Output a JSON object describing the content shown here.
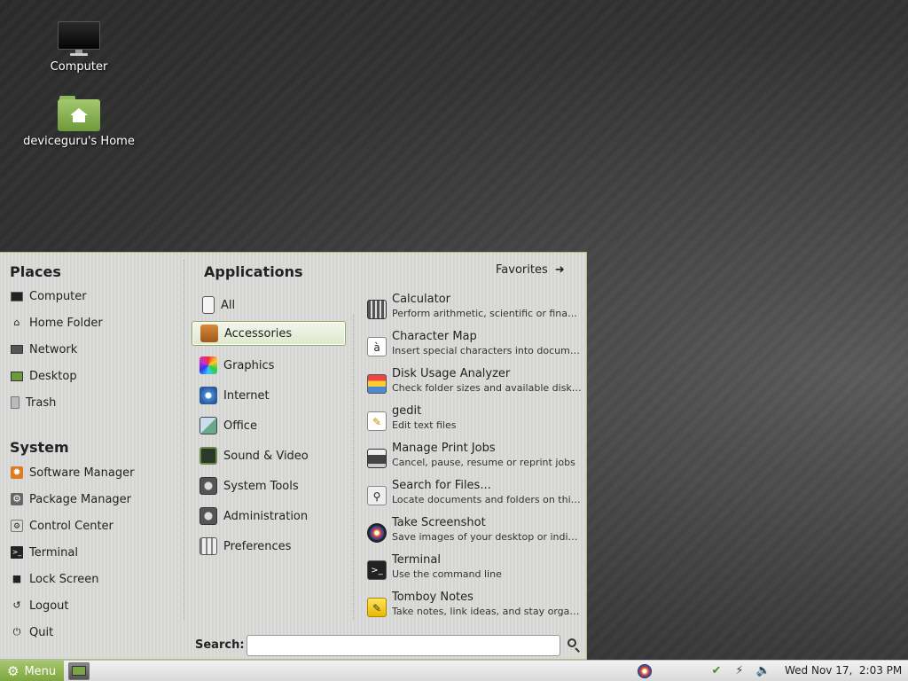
{
  "desktop": {
    "icons": [
      {
        "label": "Computer"
      },
      {
        "label": "deviceguru's Home"
      }
    ]
  },
  "menu": {
    "places_title": "Places",
    "places": [
      {
        "label": "Computer",
        "icon": "computer-icon"
      },
      {
        "label": "Home Folder",
        "icon": "home-icon"
      },
      {
        "label": "Network",
        "icon": "network-icon"
      },
      {
        "label": "Desktop",
        "icon": "desktop-icon"
      },
      {
        "label": "Trash",
        "icon": "trash-icon"
      }
    ],
    "system_title": "System",
    "system": [
      {
        "label": "Software Manager",
        "icon": "software-manager-icon"
      },
      {
        "label": "Package Manager",
        "icon": "package-manager-icon"
      },
      {
        "label": "Control Center",
        "icon": "control-center-icon"
      },
      {
        "label": "Terminal",
        "icon": "terminal-icon"
      },
      {
        "label": "Lock Screen",
        "icon": "lock-icon"
      },
      {
        "label": "Logout",
        "icon": "logout-icon"
      },
      {
        "label": "Quit",
        "icon": "power-icon"
      }
    ],
    "applications_title": "Applications",
    "favorites_label": "Favorites",
    "categories": [
      {
        "label": "All",
        "icon": "all-icon",
        "selected": false
      },
      {
        "label": "Accessories",
        "icon": "accessories-icon",
        "selected": true
      },
      {
        "label": "Graphics",
        "icon": "graphics-icon",
        "selected": false
      },
      {
        "label": "Internet",
        "icon": "internet-icon",
        "selected": false
      },
      {
        "label": "Office",
        "icon": "office-icon",
        "selected": false
      },
      {
        "label": "Sound & Video",
        "icon": "sound-video-icon",
        "selected": false
      },
      {
        "label": "System Tools",
        "icon": "system-tools-icon",
        "selected": false
      },
      {
        "label": "Administration",
        "icon": "administration-icon",
        "selected": false
      },
      {
        "label": "Preferences",
        "icon": "preferences-icon",
        "selected": false
      }
    ],
    "apps": [
      {
        "name": "Calculator",
        "desc": "Perform arithmetic, scientific or financial calculations",
        "icon": "calculator-icon"
      },
      {
        "name": "Character Map",
        "desc": "Insert special characters into documents",
        "icon": "character-map-icon"
      },
      {
        "name": "Disk Usage Analyzer",
        "desc": "Check folder sizes and available disk space",
        "icon": "disk-usage-icon"
      },
      {
        "name": "gedit",
        "desc": "Edit text files",
        "icon": "gedit-icon"
      },
      {
        "name": "Manage Print Jobs",
        "desc": "Cancel, pause, resume or reprint jobs",
        "icon": "printer-icon"
      },
      {
        "name": "Search for Files...",
        "desc": "Locate documents and folders on this computer",
        "icon": "search-files-icon"
      },
      {
        "name": "Take Screenshot",
        "desc": "Save images of your desktop or individual windows",
        "icon": "screenshot-icon"
      },
      {
        "name": "Terminal",
        "desc": "Use the command line",
        "icon": "terminal-icon"
      },
      {
        "name": "Tomboy Notes",
        "desc": "Take notes, link ideas, and stay organized",
        "icon": "notes-icon"
      }
    ],
    "search_label": "Search:",
    "search_value": ""
  },
  "taskbar": {
    "menu_label": "Menu",
    "clock": "Wed Nov 17,  2:03 PM"
  },
  "colors": {
    "accent": "#8fae5c",
    "menu_button": "#7ea43f",
    "folder": "#8fb85b"
  }
}
